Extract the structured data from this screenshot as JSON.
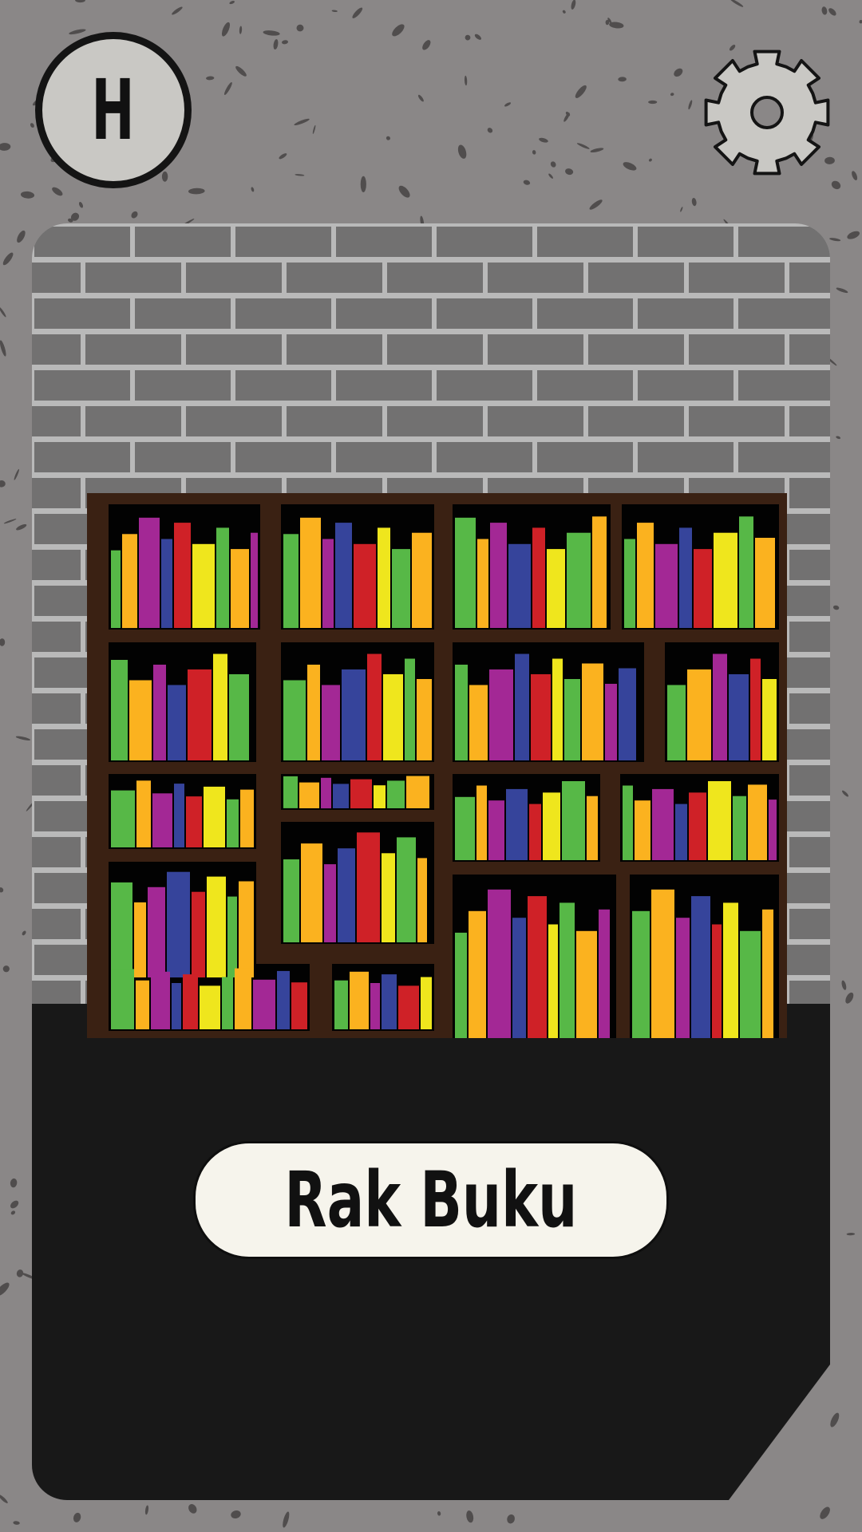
{
  "hint_button": {
    "letter": "H"
  },
  "settings_button": {
    "icon": "gear-icon"
  },
  "scene": {
    "object_label": "Rak Buku",
    "colors": {
      "background": "#8a8787",
      "brick": "#727171",
      "mortar": "#b9b9b9",
      "floor": "#181818",
      "shelf_frame": "#3a2113",
      "book_green": "#57b847",
      "book_yellow": "#efe61d",
      "book_red": "#cf2127",
      "book_blue": "#36449b",
      "book_magenta": "#a32895",
      "book_orange": "#fbb21f"
    }
  }
}
